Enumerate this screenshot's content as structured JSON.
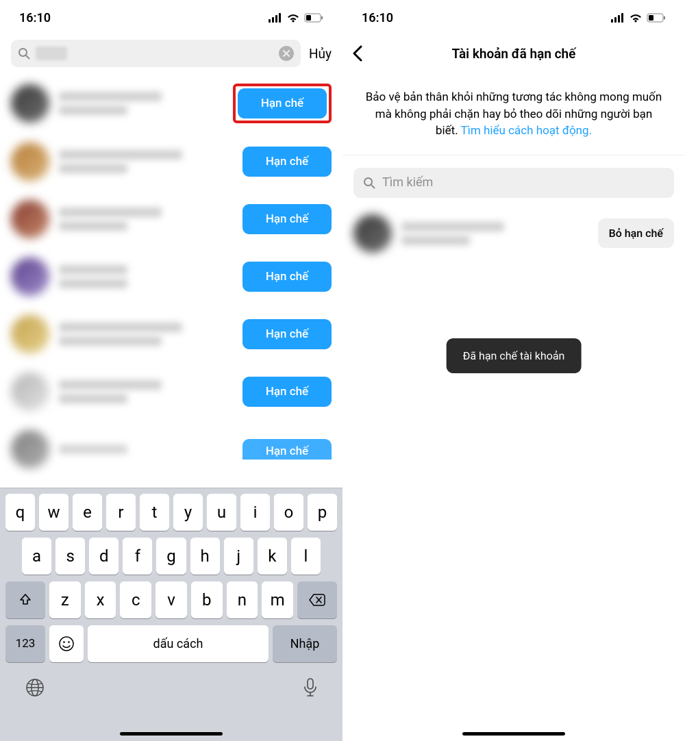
{
  "status": {
    "time": "16:10"
  },
  "left": {
    "cancel": "Hủy",
    "restrict_label": "Hạn chế",
    "rows": 7
  },
  "right": {
    "title": "Tài khoản đã hạn chế",
    "info_text": "Bảo vệ bản thân khỏi những tương tác không mong muốn mà không phải chặn hay bỏ theo dõi những người bạn biết. ",
    "info_link": "Tìm hiểu cách hoạt động.",
    "search_placeholder": "Tìm kiếm",
    "unrestrict_label": "Bỏ hạn chế",
    "toast": "Đã hạn chế tài khoản"
  },
  "keyboard": {
    "row1": [
      "q",
      "w",
      "e",
      "r",
      "t",
      "y",
      "u",
      "i",
      "o",
      "p"
    ],
    "row2": [
      "a",
      "s",
      "d",
      "f",
      "g",
      "h",
      "j",
      "k",
      "l"
    ],
    "row3": [
      "z",
      "x",
      "c",
      "v",
      "b",
      "n",
      "m"
    ],
    "numkey": "123",
    "space": "dấu cách",
    "enter": "Nhập"
  }
}
